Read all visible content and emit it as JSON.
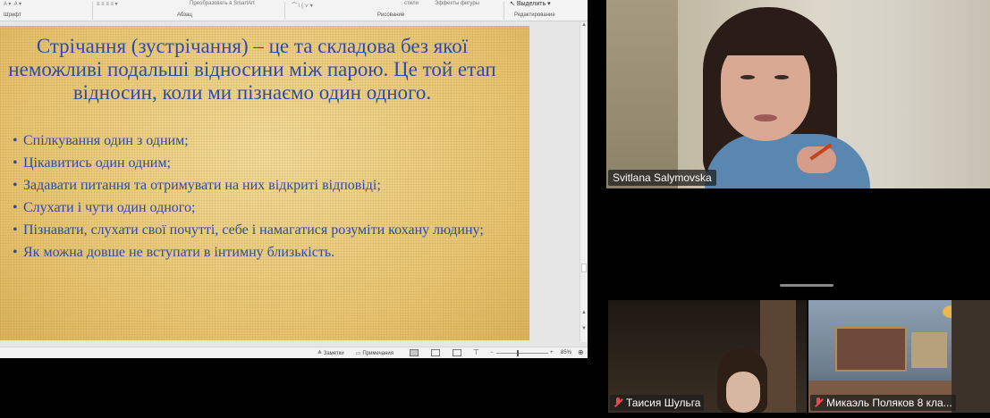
{
  "ribbon": {
    "group_font": "Шрифт",
    "group_paragraph": "Абзац",
    "smartart": "Преобразовать в SmartArt",
    "styles": "стили",
    "shape_effects": "Эффекты фигуры",
    "group_drawing": "Рисование",
    "select": "Выделить",
    "group_editing": "Редактирование"
  },
  "slide": {
    "title": "Стрічання (зустрічання) – це та складова без якої неможливі подальші відносини між парою. Це той етап відносин, коли ми пізнаємо один одного.",
    "bullets": [
      "Спілкування один з одним;",
      "Цікавитись один одним;",
      "Задавати питання та отримувати на них відкриті відповіді;",
      "Слухати і чути один одного;",
      "Пізнавати, слухати свої почутті, себе і намагатися розуміти кохану людину;",
      "Як можна довше не вступати в інтимну близькість."
    ]
  },
  "statusbar": {
    "notes": "Заметки",
    "comments": "Примечания",
    "zoom_minus": "−",
    "zoom_plus": "+",
    "zoom": "85%"
  },
  "participants": {
    "main": {
      "name": "Svitlana Salymovska"
    },
    "tile1": {
      "name": "Таисия Шульга"
    },
    "tile2": {
      "name": "Микаэль Поляков 8 кла..."
    }
  }
}
